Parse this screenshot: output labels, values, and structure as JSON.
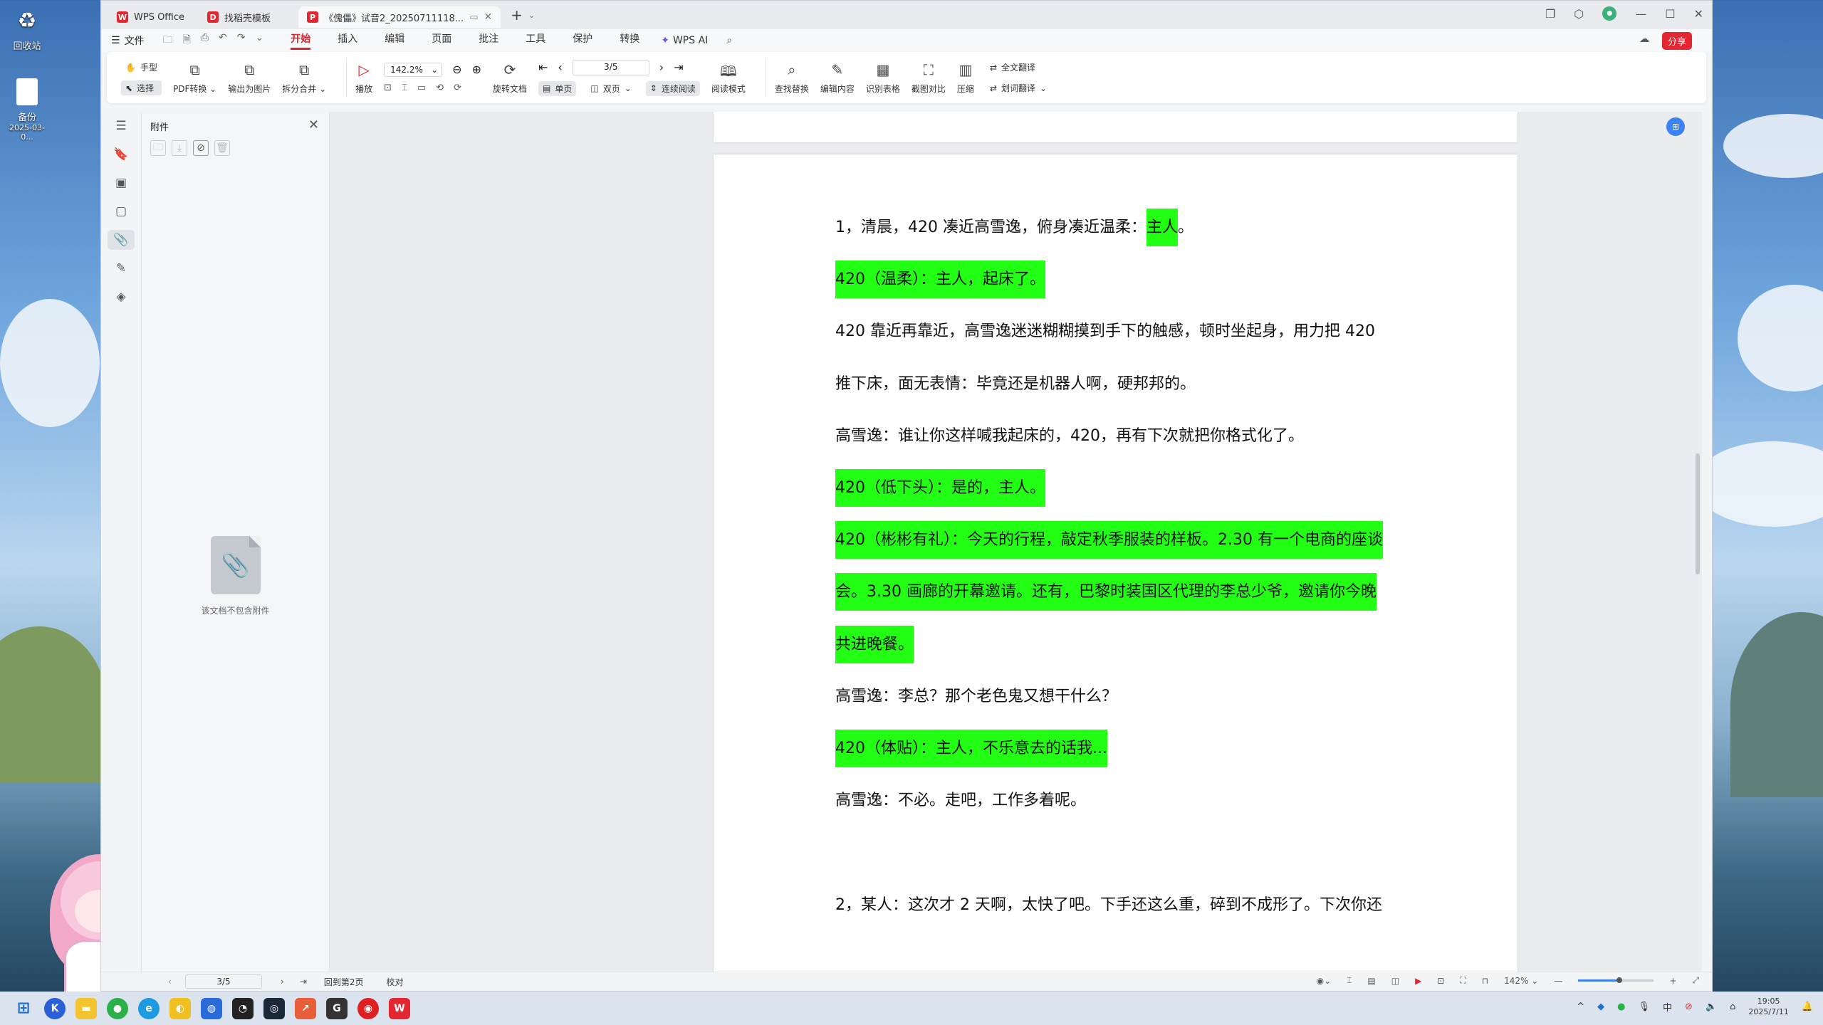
{
  "desktop": {
    "icons": [
      {
        "label": "回收站"
      },
      {
        "label": "备份",
        "sublabel": "2025-03-0..."
      }
    ]
  },
  "window": {
    "tabs": [
      {
        "label": "WPS Office",
        "icon": "wps-logo-icon"
      },
      {
        "label": "找稻壳模板",
        "icon": "docer-icon"
      },
      {
        "label": "《傀儡》试音2_20250711118...",
        "icon": "pdf-icon",
        "active": true
      }
    ],
    "new_tab": "+"
  },
  "menubar": {
    "file": "文件",
    "items": [
      "开始",
      "插入",
      "编辑",
      "页面",
      "批注",
      "工具",
      "保护",
      "转换"
    ],
    "active": "开始",
    "ai": "WPS AI",
    "share": "分享"
  },
  "ribbon": {
    "hand": "手型",
    "select": "选择",
    "pdf_convert": "PDF转换",
    "export_image": "输出为图片",
    "split_merge": "拆分合并",
    "play": "播放",
    "zoom": "142.2%",
    "rotate": "旋转文档",
    "single": "单页",
    "double": "双页",
    "continuous": "连续阅读",
    "page": "3/5",
    "read_mode": "阅读模式",
    "find_replace": "查找替换",
    "edit_content": "编辑内容",
    "recognize_table": "识别表格",
    "screenshot_compare": "截图对比",
    "compress": "压缩",
    "full_translate": "全文翻译",
    "word_translate": "划词翻译"
  },
  "panel": {
    "title": "附件",
    "empty_text": "该文档不包含附件"
  },
  "document": {
    "lines": [
      {
        "text": "1，清晨，420 凑近高雪逸，俯身凑近温柔：",
        "highlight": "主人",
        "tail": "。"
      },
      {
        "text": "420（温柔）：主人，起床了。",
        "full": true
      },
      {
        "text": "420 靠近再靠近，高雪逸迷迷糊糊摸到手下的触感，顿时坐起身，用力把 420"
      },
      {
        "text": "推下床，面无表情：毕竟还是机器人啊，硬邦邦的。"
      },
      {
        "text": "高雪逸：谁让你这样喊我起床的，420，再有下次就把你格式化了。"
      },
      {
        "text": "420（低下头）：是的，主人。",
        "full": true
      },
      {
        "text": "420（彬彬有礼）：今天的行程，敲定秋季服装的样板。2.30 有一个电商的座谈",
        "full": true
      },
      {
        "text": "会。3.30 画廊的开幕邀请。还有，巴黎时装国区代理的李总少爷，邀请你今晚",
        "full": true
      },
      {
        "text": "共进晚餐。",
        "full": true
      },
      {
        "text": "高雪逸：李总？那个老色鬼又想干什么？"
      },
      {
        "text": "420（体贴）：主人，不乐意去的话我...",
        "full": true
      },
      {
        "text": "高雪逸：不必。走吧，工作多着呢。"
      },
      {
        "text": "2，某人：这次才 2 天啊，太快了吧。下手还这么重，碎到不成形了。下次你还"
      }
    ]
  },
  "statusbar": {
    "page": "3/5",
    "back": "回到第2页",
    "proofread": "校对",
    "zoom": "142%"
  },
  "taskbar": {
    "time": "19:05",
    "date": "2025/7/11"
  },
  "colors": {
    "highlight": "#22ff14",
    "accent": "#d9232e"
  }
}
